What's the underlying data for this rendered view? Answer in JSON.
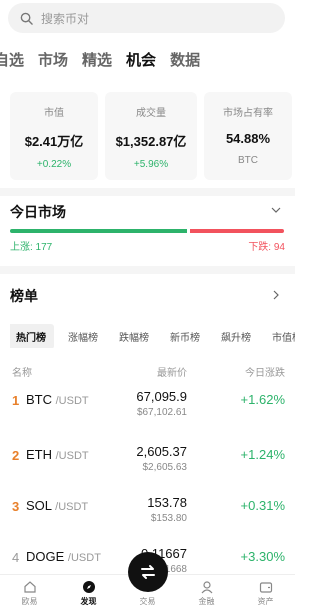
{
  "search": {
    "placeholder": "搜索币对"
  },
  "top_tabs": [
    {
      "label": "自选"
    },
    {
      "label": "市场"
    },
    {
      "label": "精选"
    },
    {
      "label": "机会",
      "active": true
    },
    {
      "label": "数据"
    }
  ],
  "stats": [
    {
      "label": "市值",
      "value": "$2.41万亿",
      "sub": "+0.22%",
      "sub_color": "#2db36b"
    },
    {
      "label": "成交量",
      "value": "$1,352.87亿",
      "sub": "+5.96%",
      "sub_color": "#2db36b"
    },
    {
      "label": "市场占有率",
      "value": "54.88%",
      "sub": "BTC",
      "sub_color": "#888888"
    }
  ],
  "today_market": {
    "title": "今日市场",
    "up_label": "上涨: 177",
    "down_label": "下跌: 94",
    "up_count": 177,
    "down_count": 94,
    "up_color": "#2db36b",
    "down_color": "#f2525d"
  },
  "ranking": {
    "title": "榜单",
    "filters": [
      "热门榜",
      "涨幅榜",
      "跌幅榜",
      "新币榜",
      "飙升榜",
      "市值榜"
    ],
    "active_filter": "热门榜",
    "columns": {
      "name": "名称",
      "price": "最新价",
      "change": "今日涨跌"
    },
    "rows": [
      {
        "rank": "1",
        "symbol": "BTC",
        "pair": "/USDT",
        "price": "67,095.9",
        "price_usd": "$67,102.61",
        "change": "+1.62%"
      },
      {
        "rank": "2",
        "symbol": "ETH",
        "pair": "/USDT",
        "price": "2,605.37",
        "price_usd": "$2,605.63",
        "change": "+1.24%"
      },
      {
        "rank": "3",
        "symbol": "SOL",
        "pair": "/USDT",
        "price": "153.78",
        "price_usd": "$153.80",
        "change": "+0.31%"
      },
      {
        "rank": "4",
        "symbol": "DOGE",
        "pair": "/USDT",
        "price": "0.11667",
        "price_usd": "$0.11668",
        "change": "+3.30%"
      }
    ]
  },
  "bottom_nav": [
    {
      "label": "欧易",
      "icon": "home-icon"
    },
    {
      "label": "发现",
      "icon": "discover-icon",
      "active": true
    },
    {
      "label": "交易",
      "icon": "trade-icon"
    },
    {
      "label": "金融",
      "icon": "finance-icon"
    },
    {
      "label": "资产",
      "icon": "wallet-icon"
    }
  ],
  "accent_colors": {
    "rise": "#2db36b",
    "fall": "#f2525d",
    "rank_top": "#e8802b"
  }
}
